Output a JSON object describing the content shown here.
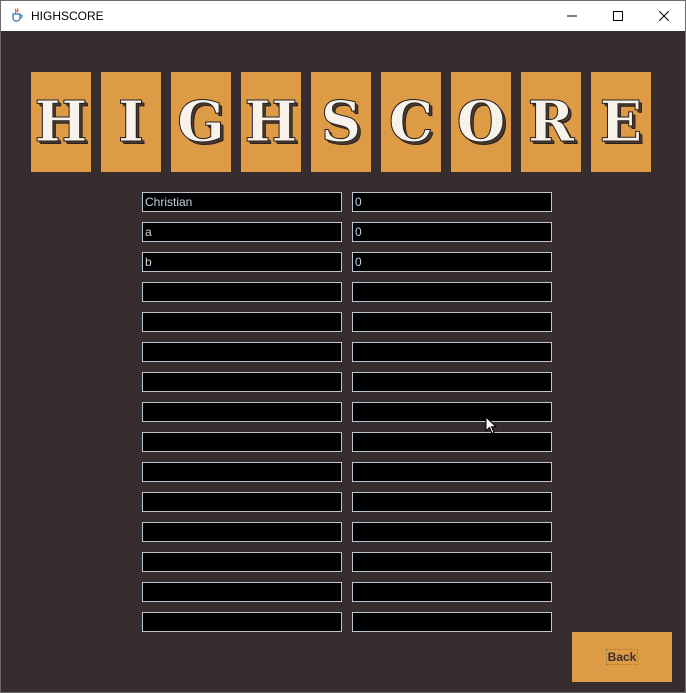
{
  "window": {
    "title": "HIGHSCORE"
  },
  "banner": {
    "letters": [
      "H",
      "I",
      "G",
      "H",
      "S",
      "C",
      "O",
      "R",
      "E"
    ]
  },
  "entries": [
    {
      "name": "Christian",
      "score": "0"
    },
    {
      "name": "a",
      "score": "0"
    },
    {
      "name": "b",
      "score": "0"
    },
    {
      "name": "",
      "score": ""
    },
    {
      "name": "",
      "score": ""
    },
    {
      "name": "",
      "score": ""
    },
    {
      "name": "",
      "score": ""
    },
    {
      "name": "",
      "score": ""
    },
    {
      "name": "",
      "score": ""
    },
    {
      "name": "",
      "score": ""
    },
    {
      "name": "",
      "score": ""
    },
    {
      "name": "",
      "score": ""
    },
    {
      "name": "",
      "score": ""
    },
    {
      "name": "",
      "score": ""
    },
    {
      "name": "",
      "score": ""
    }
  ],
  "back_button": {
    "label": "Back"
  },
  "colors": {
    "background": "#372c2e",
    "accent": "#de9b46",
    "field_bg": "#000000",
    "field_border": "#b9c4d1"
  },
  "icons": {
    "app": "java-cup-icon",
    "minimize": "minimize-icon",
    "maximize": "maximize-icon",
    "close": "close-icon",
    "cursor": "mouse-pointer-icon"
  }
}
